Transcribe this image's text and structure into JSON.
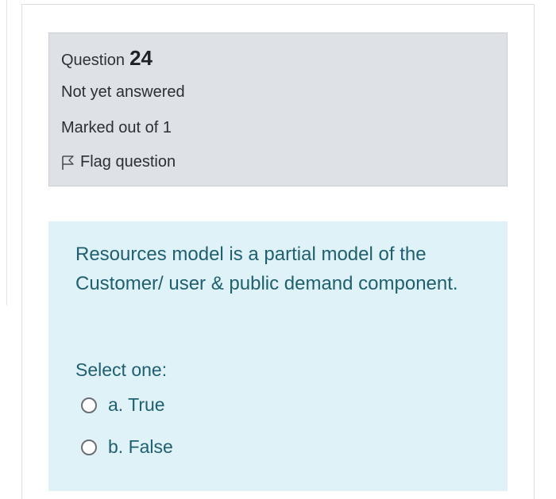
{
  "question": {
    "label": "Question",
    "number": "24",
    "state": "Not yet answered",
    "grade": "Marked out of 1",
    "flag_label": "Flag question",
    "flag_icon": "flag-outline-icon"
  },
  "formulation": {
    "text": "Resources model is a partial model of the Customer/ user & public demand component.",
    "prompt": "Select one:",
    "options": [
      {
        "label": "a. True",
        "selected": false
      },
      {
        "label": "b. False",
        "selected": false
      }
    ]
  },
  "colors": {
    "info_background": "#dee2e6",
    "formulation_background": "#def2f8",
    "formulation_text": "#1f5f6f"
  }
}
